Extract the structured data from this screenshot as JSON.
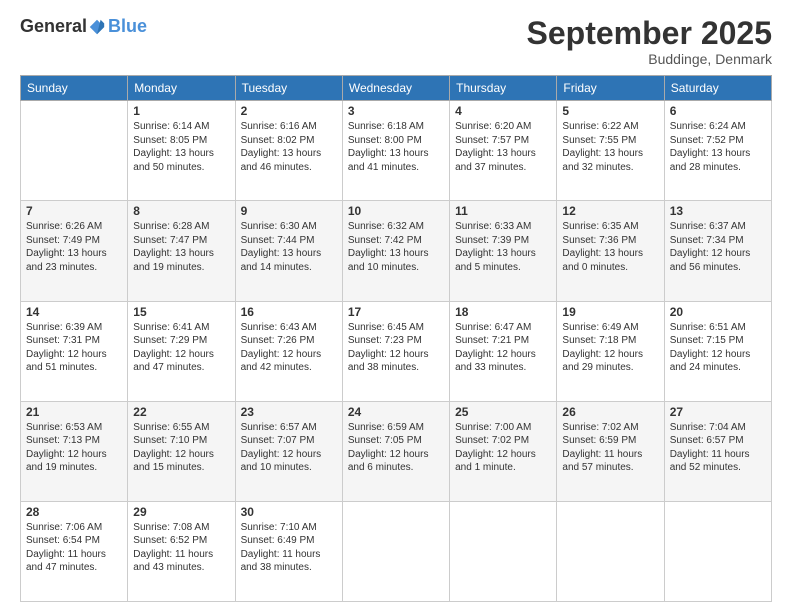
{
  "logo": {
    "general": "General",
    "blue": "Blue"
  },
  "title": "September 2025",
  "subtitle": "Buddinge, Denmark",
  "days_of_week": [
    "Sunday",
    "Monday",
    "Tuesday",
    "Wednesday",
    "Thursday",
    "Friday",
    "Saturday"
  ],
  "weeks": [
    [
      {
        "day": "",
        "info": ""
      },
      {
        "day": "1",
        "info": "Sunrise: 6:14 AM\nSunset: 8:05 PM\nDaylight: 13 hours\nand 50 minutes."
      },
      {
        "day": "2",
        "info": "Sunrise: 6:16 AM\nSunset: 8:02 PM\nDaylight: 13 hours\nand 46 minutes."
      },
      {
        "day": "3",
        "info": "Sunrise: 6:18 AM\nSunset: 8:00 PM\nDaylight: 13 hours\nand 41 minutes."
      },
      {
        "day": "4",
        "info": "Sunrise: 6:20 AM\nSunset: 7:57 PM\nDaylight: 13 hours\nand 37 minutes."
      },
      {
        "day": "5",
        "info": "Sunrise: 6:22 AM\nSunset: 7:55 PM\nDaylight: 13 hours\nand 32 minutes."
      },
      {
        "day": "6",
        "info": "Sunrise: 6:24 AM\nSunset: 7:52 PM\nDaylight: 13 hours\nand 28 minutes."
      }
    ],
    [
      {
        "day": "7",
        "info": "Sunrise: 6:26 AM\nSunset: 7:49 PM\nDaylight: 13 hours\nand 23 minutes."
      },
      {
        "day": "8",
        "info": "Sunrise: 6:28 AM\nSunset: 7:47 PM\nDaylight: 13 hours\nand 19 minutes."
      },
      {
        "day": "9",
        "info": "Sunrise: 6:30 AM\nSunset: 7:44 PM\nDaylight: 13 hours\nand 14 minutes."
      },
      {
        "day": "10",
        "info": "Sunrise: 6:32 AM\nSunset: 7:42 PM\nDaylight: 13 hours\nand 10 minutes."
      },
      {
        "day": "11",
        "info": "Sunrise: 6:33 AM\nSunset: 7:39 PM\nDaylight: 13 hours\nand 5 minutes."
      },
      {
        "day": "12",
        "info": "Sunrise: 6:35 AM\nSunset: 7:36 PM\nDaylight: 13 hours\nand 0 minutes."
      },
      {
        "day": "13",
        "info": "Sunrise: 6:37 AM\nSunset: 7:34 PM\nDaylight: 12 hours\nand 56 minutes."
      }
    ],
    [
      {
        "day": "14",
        "info": "Sunrise: 6:39 AM\nSunset: 7:31 PM\nDaylight: 12 hours\nand 51 minutes."
      },
      {
        "day": "15",
        "info": "Sunrise: 6:41 AM\nSunset: 7:29 PM\nDaylight: 12 hours\nand 47 minutes."
      },
      {
        "day": "16",
        "info": "Sunrise: 6:43 AM\nSunset: 7:26 PM\nDaylight: 12 hours\nand 42 minutes."
      },
      {
        "day": "17",
        "info": "Sunrise: 6:45 AM\nSunset: 7:23 PM\nDaylight: 12 hours\nand 38 minutes."
      },
      {
        "day": "18",
        "info": "Sunrise: 6:47 AM\nSunset: 7:21 PM\nDaylight: 12 hours\nand 33 minutes."
      },
      {
        "day": "19",
        "info": "Sunrise: 6:49 AM\nSunset: 7:18 PM\nDaylight: 12 hours\nand 29 minutes."
      },
      {
        "day": "20",
        "info": "Sunrise: 6:51 AM\nSunset: 7:15 PM\nDaylight: 12 hours\nand 24 minutes."
      }
    ],
    [
      {
        "day": "21",
        "info": "Sunrise: 6:53 AM\nSunset: 7:13 PM\nDaylight: 12 hours\nand 19 minutes."
      },
      {
        "day": "22",
        "info": "Sunrise: 6:55 AM\nSunset: 7:10 PM\nDaylight: 12 hours\nand 15 minutes."
      },
      {
        "day": "23",
        "info": "Sunrise: 6:57 AM\nSunset: 7:07 PM\nDaylight: 12 hours\nand 10 minutes."
      },
      {
        "day": "24",
        "info": "Sunrise: 6:59 AM\nSunset: 7:05 PM\nDaylight: 12 hours\nand 6 minutes."
      },
      {
        "day": "25",
        "info": "Sunrise: 7:00 AM\nSunset: 7:02 PM\nDaylight: 12 hours\nand 1 minute."
      },
      {
        "day": "26",
        "info": "Sunrise: 7:02 AM\nSunset: 6:59 PM\nDaylight: 11 hours\nand 57 minutes."
      },
      {
        "day": "27",
        "info": "Sunrise: 7:04 AM\nSunset: 6:57 PM\nDaylight: 11 hours\nand 52 minutes."
      }
    ],
    [
      {
        "day": "28",
        "info": "Sunrise: 7:06 AM\nSunset: 6:54 PM\nDaylight: 11 hours\nand 47 minutes."
      },
      {
        "day": "29",
        "info": "Sunrise: 7:08 AM\nSunset: 6:52 PM\nDaylight: 11 hours\nand 43 minutes."
      },
      {
        "day": "30",
        "info": "Sunrise: 7:10 AM\nSunset: 6:49 PM\nDaylight: 11 hours\nand 38 minutes."
      },
      {
        "day": "",
        "info": ""
      },
      {
        "day": "",
        "info": ""
      },
      {
        "day": "",
        "info": ""
      },
      {
        "day": "",
        "info": ""
      }
    ]
  ]
}
